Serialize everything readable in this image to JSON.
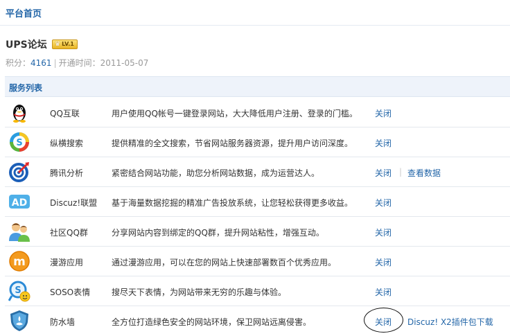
{
  "page": {
    "title": "平台首页"
  },
  "site": {
    "name": "UPS论坛",
    "level_badge": "LV.1",
    "points_label": "积分：",
    "points": "4161",
    "separator": "|",
    "open_time_label": "开通时间：",
    "open_time": "2011-05-07"
  },
  "services": {
    "header": "服务列表",
    "rows": [
      {
        "icon": "qq-penguin-icon",
        "name": "QQ互联",
        "desc": "用户使用QQ帐号一键登录网站，大大降低用户注册、登录的门槛。",
        "action": "关闭"
      },
      {
        "icon": "soso-search-icon",
        "name": "纵横搜索",
        "desc": "提供精准的全文搜索，节省网站服务器资源，提升用户访问深度。",
        "action": "关闭"
      },
      {
        "icon": "analytics-target-icon",
        "name": "腾讯分析",
        "desc": "紧密结合网站功能，助您分析网站数据，成为运营达人。",
        "action": "关闭",
        "action2": "查看数据"
      },
      {
        "icon": "ad-icon",
        "name": "Discuz!联盟",
        "desc": "基于海量数据挖掘的精准广告投放系统，让您轻松获得更多收益。",
        "action": "关闭"
      },
      {
        "icon": "community-group-icon",
        "name": "社区QQ群",
        "desc": "分享网站内容到绑定的QQ群，提升网站粘性，增强互动。",
        "action": "关闭"
      },
      {
        "icon": "manyou-app-icon",
        "name": "漫游应用",
        "desc": "通过漫游应用，可以在您的网站上快速部署数百个优秀应用。",
        "action": "关闭"
      },
      {
        "icon": "soso-emoticon-icon",
        "name": "SOSO表情",
        "desc": "搜尽天下表情，为网站带来无穷的乐趣与体验。",
        "action": "关闭"
      },
      {
        "icon": "firewall-shield-icon",
        "name": "防水墙",
        "desc": "全方位打造绿色安全的网站环境，保卫网站远离侵害。",
        "action": "关闭",
        "action2": "Discuz! X2插件包下载"
      }
    ]
  },
  "colors": {
    "link": "#2366a8",
    "header_bg": "#eef3fa",
    "muted": "#999999"
  }
}
